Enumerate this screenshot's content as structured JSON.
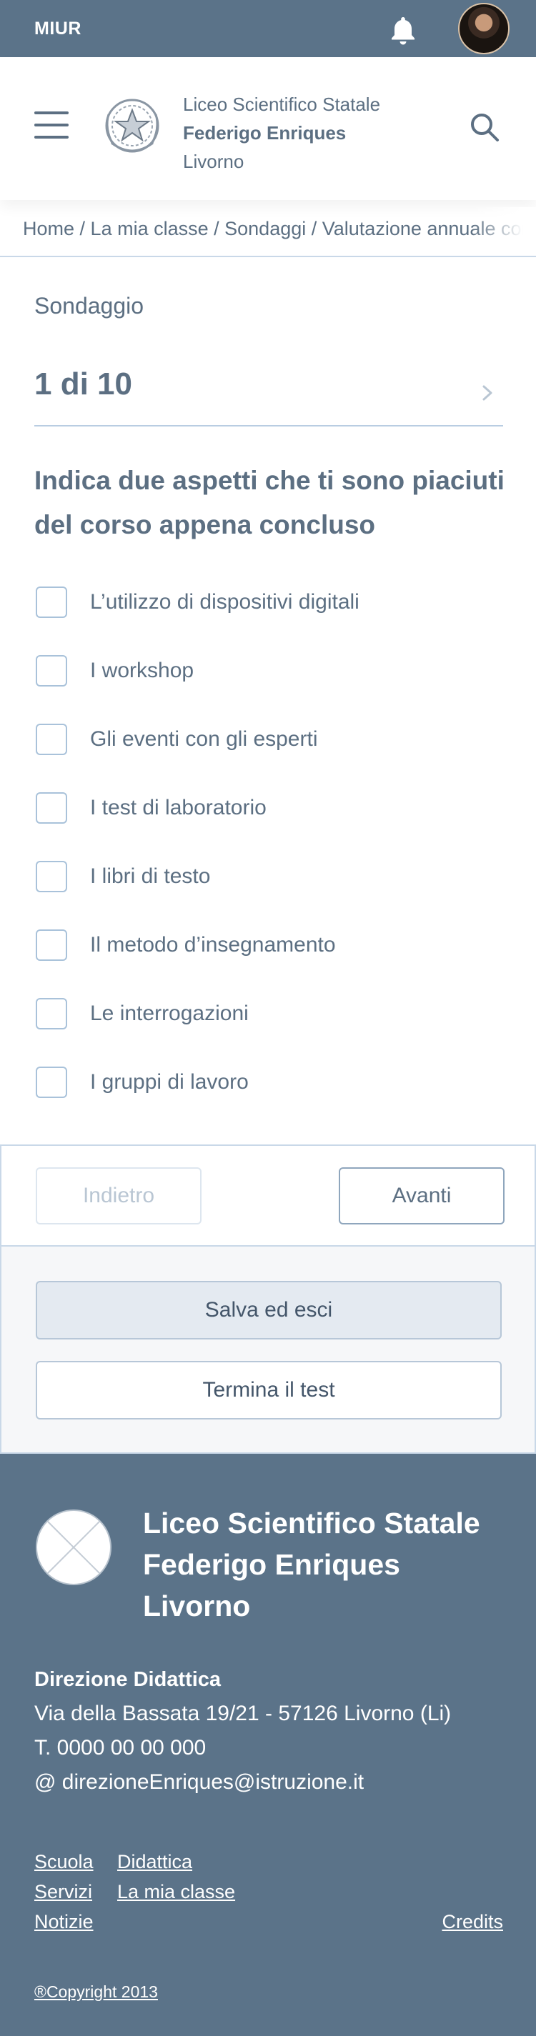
{
  "topbar": {
    "brand": "MIUR",
    "bell_icon": "bell-icon",
    "avatar_icon": "user-avatar"
  },
  "header": {
    "menu_icon": "hamburger-menu-icon",
    "school_line1": "Liceo Scientifico Statale",
    "school_line2": "Federigo Enriques",
    "school_line3": "Livorno",
    "search_icon": "search-icon"
  },
  "breadcrumb": {
    "items": [
      "Home",
      "La mia classe",
      "Sondaggi",
      "Valutazione annuale corso"
    ],
    "separator": " / "
  },
  "survey": {
    "label": "Sondaggio",
    "pager": "1 di 10",
    "question": "Indica due aspetti che ti sono piaciuti del corso appena concluso",
    "options": [
      "L’utilizzo di dispositivi digitali",
      "I workshop",
      "Gli eventi con gli esperti",
      "I test di laboratorio",
      "I libri di testo",
      "Il metodo d’insegnamento",
      "Le interrogazioni",
      "I gruppi di lavoro"
    ]
  },
  "nav": {
    "back_label": "Indietro",
    "next_label": "Avanti",
    "save_label": "Salva ed esci",
    "end_label": "Termina il test"
  },
  "footer": {
    "title_line1": "Liceo Scientifico Statale",
    "title_line2": "Federigo Enriques",
    "title_line3": "Livorno",
    "direction_title": "Direzione Didattica",
    "address": "Via della Bassata 19/21 - 57126 Livorno (Li)",
    "phone": "T. 0000 00 00 000",
    "email": "@ direzioneEnriques@istruzione.it",
    "links": {
      "scuola": "Scuola",
      "didattica": "Didattica",
      "servizi": "Servizi",
      "mia_classe": "La mia classe",
      "notizie": "Notizie",
      "credits": "Credits"
    },
    "copyright": "®Copyright 2013"
  },
  "colors": {
    "primary": "#5b7389",
    "text": "#5c6f82",
    "border": "#c9d8e8"
  }
}
